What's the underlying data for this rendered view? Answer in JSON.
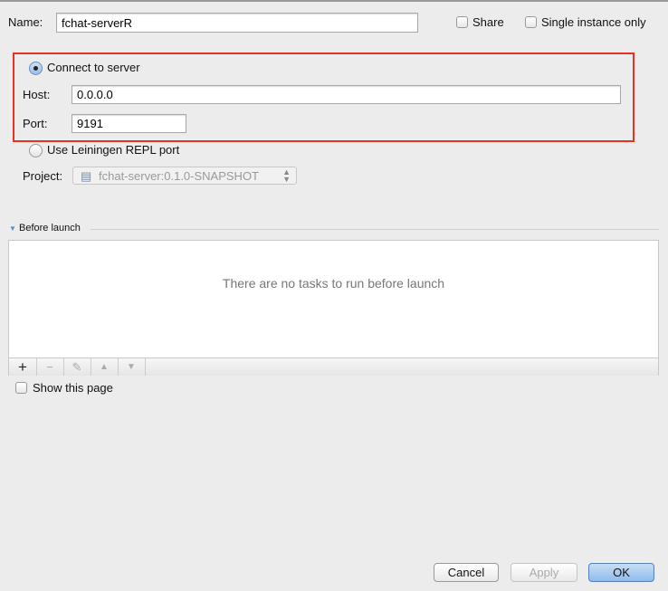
{
  "name": {
    "label": "Name:",
    "value": "fchat-serverR"
  },
  "share": {
    "label": "Share",
    "checked": false
  },
  "single_instance": {
    "label": "Single instance only",
    "checked": false
  },
  "connect": {
    "label": "Connect to server",
    "selected": true
  },
  "host": {
    "label": "Host:",
    "value": "0.0.0.0"
  },
  "port": {
    "label": "Port:",
    "value": "9191"
  },
  "leiningen": {
    "label": "Use Leiningen REPL port",
    "selected": false
  },
  "project": {
    "label": "Project:",
    "value": "fchat-server:0.1.0-SNAPSHOT"
  },
  "before_launch": {
    "title": "Before launch",
    "empty_text": "There are no tasks to run before launch",
    "toolbar": [
      "add-icon",
      "remove-icon",
      "edit-icon",
      "move-up-icon",
      "move-down-icon"
    ]
  },
  "show_page": {
    "label": "Show this page",
    "checked": false
  },
  "buttons": {
    "cancel": "Cancel",
    "apply": "Apply",
    "ok": "OK"
  },
  "colors": {
    "highlight": "#e8321f",
    "ok_button": "#9cc4ef"
  }
}
